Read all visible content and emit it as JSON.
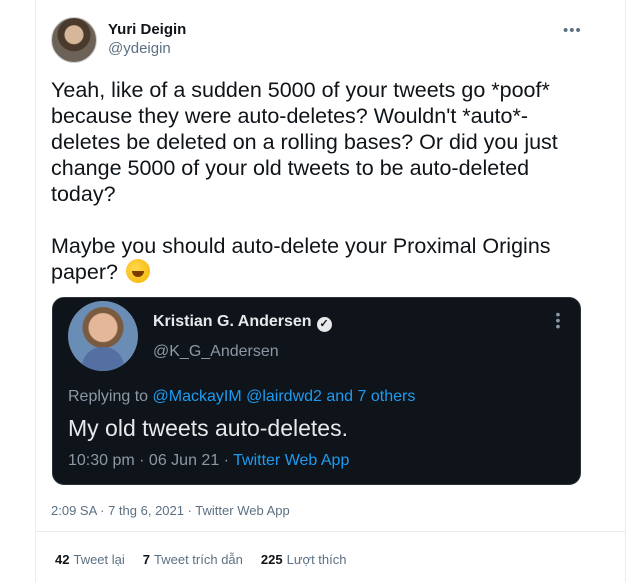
{
  "tweet": {
    "author_name": "Yuri Deigin",
    "author_handle": "@ydeigin",
    "more_icon": "more-horizontal-icon",
    "text": "Yeah, like of a sudden 5000 of your tweets go *poof* because they were auto-deletes? Wouldn't *auto*-deletes be deleted on a rolling bases? Or did you just change 5000 of your old tweets to be auto-deleted today?\n\nMaybe you should auto-delete your Proximal Origins paper?",
    "emoji": "rolling-on-floor-laughing-emoji",
    "timestamp": "2:09 SA · 7 thg 6, 2021 · Twitter Web App",
    "stats": {
      "retweets_count": "42",
      "retweets_label": "Tweet lại",
      "quotes_count": "7",
      "quotes_label": "Tweet trích dẫn",
      "likes_count": "225",
      "likes_label": "Lượt thích"
    }
  },
  "quoted_tweet": {
    "author_name": "Kristian G. Andersen",
    "verified_icon": "verified-badge-icon",
    "author_handle": "@K_G_Andersen",
    "replying_prefix": "Replying to",
    "replying_to": "@MackayIM @lairdwd2 and 7 others",
    "text": "My old tweets auto-deletes.",
    "time": "10:30 pm · 06 Jun 21 · ",
    "source": "Twitter Web App"
  },
  "colors": {
    "accent": "#1d9bf0",
    "quote_bg": "#0f141a",
    "muted": "#5b7083"
  }
}
